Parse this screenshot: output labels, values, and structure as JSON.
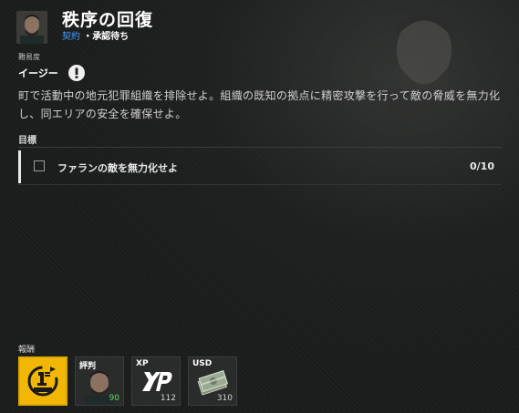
{
  "mission": {
    "title": "秩序の回復",
    "type_link": "契約",
    "status": "承認待ち"
  },
  "difficulty": {
    "label": "難易度",
    "value": "イージー"
  },
  "description": "町で活動中の地元犯罪組織を排除せよ。組織の既知の拠点に精密攻撃を行って敵の脅威を無力化し、同エリアの安全を確保せよ。",
  "objectives": {
    "header": "目標",
    "items": [
      {
        "text": "ファランの敵を無力化せよ",
        "count": "0/10"
      }
    ]
  },
  "rewards": {
    "label": "報酬",
    "items": [
      {
        "title": "",
        "icon": "first-time-icon",
        "amount": ""
      },
      {
        "title": "評判",
        "icon": "faction-portrait",
        "amount": "90"
      },
      {
        "title": "XP",
        "icon": "xp-icon",
        "amount": "112"
      },
      {
        "title": "USD",
        "icon": "cash-stack-icon",
        "amount": "310"
      }
    ]
  },
  "colors": {
    "accent_link": "#3f9bff",
    "first_time_gold": "#f2b705",
    "reputation_green": "#5ee05e"
  }
}
